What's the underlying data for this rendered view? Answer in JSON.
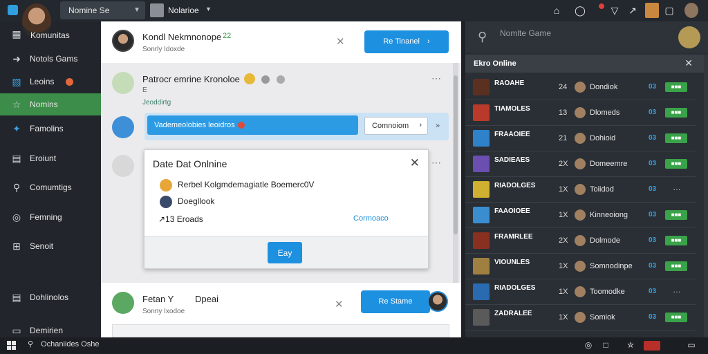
{
  "topbar": {
    "search_value": "Nomine Se",
    "profile_label": "Nolarioe",
    "icons": [
      "home-icon",
      "chat-icon",
      "wifi-icon",
      "tool-icon",
      "window-icon"
    ],
    "colors": {
      "accent": "#2f9fe0",
      "notification": "#e0403a"
    }
  },
  "sidebar": {
    "user_name": "Komunitas",
    "items": [
      {
        "label": "Notols Gams",
        "icon": "wrench-icon"
      },
      {
        "label": "Leoins",
        "icon": "cube-icon"
      },
      {
        "label": "Nomins",
        "icon": "star-icon"
      },
      {
        "label": "Famolins",
        "icon": "bird-icon"
      },
      {
        "label": "Eroiunt",
        "icon": "document-icon"
      },
      {
        "label": "Comumtigs",
        "icon": "search-icon"
      },
      {
        "label": "Femning",
        "icon": "target-icon"
      },
      {
        "label": "Senoit",
        "icon": "grid-icon"
      },
      {
        "label": "Dohlinolos",
        "icon": "page-icon"
      },
      {
        "label": "Demirien",
        "icon": "monitor-icon"
      }
    ],
    "active_index": 2,
    "active_color": "#3d8d4a"
  },
  "main": {
    "card_top": {
      "title": "Kondl Nekmnonope",
      "title_suffix": "22",
      "subtitle": "Sonrly   Idoxde",
      "button": "Re Tinanel"
    },
    "post1": {
      "title": "Patrocr emrine Kronoloe",
      "sub": "E",
      "tag": "Jeoddirtg"
    },
    "banner": {
      "text": "Vademeolobies leoidros",
      "select_value": "Comnoiom",
      "right_glyph": "»"
    },
    "dialog": {
      "title": "Date Dat Onlnine",
      "rows": [
        "Rerbel Kolgmdemagiatle Boemerc0V",
        "Doegllook",
        "↗13 Eroads"
      ],
      "link": "Cormoaco",
      "button": "Eay"
    },
    "card_bottom": {
      "title": "Fetan Y",
      "title2": "Dpeai",
      "subtitle": "Sonny  Ixodoe",
      "button": "Re Stame"
    }
  },
  "rightpane": {
    "search_placeholder": "Nomlte Game",
    "header": "Ekro Online",
    "games": [
      {
        "name": "RAOAHE",
        "sub": "—  —",
        "num": "24",
        "player": "Dondiok",
        "stat": "03",
        "pill": "■■■",
        "thumb": "#5a3020"
      },
      {
        "name": "TIAMOLES",
        "sub": "",
        "num": "13",
        "player": "Dlomeds",
        "stat": "03",
        "pill": "■■■",
        "thumb": "#b93a2a"
      },
      {
        "name": "FRAAOIEE",
        "sub": "",
        "num": "21",
        "player": "Dohioid",
        "stat": "03",
        "pill": "■■■",
        "thumb": "#2f82c9"
      },
      {
        "name": "SADIEAES",
        "sub": "",
        "num": "2X",
        "player": "Domeemre",
        "stat": "03",
        "pill": "■■■",
        "thumb": "#6a4fb0"
      },
      {
        "name": "RIADOLGES",
        "sub": "",
        "num": "1X",
        "player": "Toiidod",
        "stat": "03",
        "pill": "…",
        "thumb": "#d0b030"
      },
      {
        "name": "FAAOIOEE",
        "sub": "",
        "num": "1X",
        "player": "Kinneoiong",
        "stat": "03",
        "pill": "■■■",
        "thumb": "#3a8ed0"
      },
      {
        "name": "FRAMRLEE",
        "sub": "",
        "num": "2X",
        "player": "Dolmode",
        "stat": "03",
        "pill": "■■■",
        "thumb": "#8a3020"
      },
      {
        "name": "VIOUNLES",
        "sub": "",
        "num": "1X",
        "player": "Somnodinpe",
        "stat": "03",
        "pill": "■■■",
        "thumb": "#a08040"
      },
      {
        "name": "RIADOLGES",
        "sub": "",
        "num": "1X",
        "player": "Toomodke",
        "stat": "03",
        "pill": "…",
        "thumb": "#2a6ab0"
      },
      {
        "name": "ZADRALEE",
        "sub": "",
        "num": "1X",
        "player": "Somiok",
        "stat": "03",
        "pill": "■■■",
        "thumb": "#5a5a5a"
      }
    ]
  },
  "taskbar": {
    "search_text": "Ochaniides Oshe"
  }
}
